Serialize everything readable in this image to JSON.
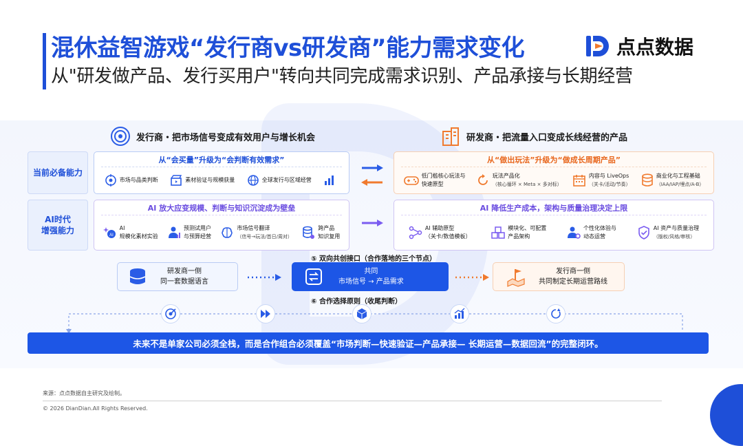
{
  "header": {
    "title": "混休益智游戏“发行商vs研发商”能力需求变化",
    "subtitle": "从\"研发做产品、发行买用户\"转向共同完成需求识别、产品承接与长期经营",
    "logo_text": "点点数据"
  },
  "columns": {
    "publisher_header": "发行商・把市场信号变成有效用户与增长机会",
    "developer_header": "研发商・把流量入口变成长线经营的产品"
  },
  "row_labels": {
    "current": "当前必备能力",
    "ai_line1": "AI时代",
    "ai_line2": "增强能力"
  },
  "publisher_current": {
    "title": "从“会买量”升级为“会判断有效需求”",
    "items": [
      {
        "icon": "target-icon",
        "text": "市场与品类判断"
      },
      {
        "icon": "clapper-icon",
        "text": "素材验证与规模获量"
      },
      {
        "icon": "globe-icon",
        "text": "全球发行与区域经营"
      },
      {
        "icon": "bar-chart-icon",
        "text": ""
      }
    ]
  },
  "developer_current": {
    "title": "从“做出玩法”升级为“做成长周期产品”",
    "items": [
      {
        "icon": "gamepad-icon",
        "line1": "低门槛核心玩法与",
        "line2": "快速原型"
      },
      {
        "icon": "cycle-icon",
        "line1": "玩法产品化",
        "line2": "（核心循环 × Meta × 多对标）"
      },
      {
        "icon": "calendar-icon",
        "line1": "内容与 LiveOps",
        "line2": "（关卡/活动/节奏）"
      },
      {
        "icon": "database-icon",
        "line1": "商业化与工程基础",
        "line2": "（IAA/IAP/埋点/A-B）"
      }
    ]
  },
  "publisher_ai": {
    "title": "AI 放大应变规模、判断与知识沉淀成为壁垒",
    "items": [
      {
        "icon": "ai-sparkle-icon",
        "line1": "AI",
        "line2": "规模化素材实验"
      },
      {
        "icon": "person-chart-icon",
        "line1": "预测试用户",
        "line2": "与预算经营"
      },
      {
        "icon": "brain-icon",
        "line1": "市场信号翻译",
        "line2": "（信号→玩法/首日/周对）"
      },
      {
        "icon": "database-stack-icon",
        "line1": "跨产品",
        "line2": "知识复用"
      }
    ]
  },
  "developer_ai": {
    "title": "AI 降低生产成本，架构与质量治理决定上限",
    "items": [
      {
        "icon": "nodes-icon",
        "line1": "AI 辅助原型",
        "line2": "（关卡/数值模板）"
      },
      {
        "icon": "cubes-icon",
        "line1": "模块化、可配置",
        "line2": "产品架构"
      },
      {
        "icon": "person-gear-icon",
        "line1": "个性化体验与",
        "line2": "动态运营"
      },
      {
        "icon": "shield-check-icon",
        "line1": "AI 资产与质量治理",
        "line2": "（版权/风格/审核）"
      }
    ]
  },
  "collab": {
    "interface_label": "⑤ 双向共创接口（合作落地的三个节点）",
    "left_node_line1": "研发商一侧",
    "left_node_line2": "同一套数据语言",
    "center_node_line1": "共同",
    "center_node_line2": "市场信号 → 产品需求",
    "right_node_line1": "发行商一侧",
    "right_node_line2": "共同制定长期运营路线",
    "principle_label": "⑥ 合作选择原则（收尾判断）"
  },
  "flow_icons": [
    "target-arrow-icon",
    "fast-forward-icon",
    "cube-icon",
    "growth-chart-icon",
    "loop-icon"
  ],
  "banner": "未来不是单家公司必须全栈，而是合作组合必须覆盖“市场判断—快速验证—产品承接— 长期运营—数据回流”的完整闭环。",
  "footer": {
    "source": "来源：点点数据自主研究及绘制。",
    "copyright": "© 2026 DianDian.All Rights Reserved."
  },
  "colors": {
    "brand_blue": "#1e4fd8",
    "publisher_blue": "#2a5ce6",
    "developer_orange": "#f07a2e",
    "ai_purple": "#7a5cf0"
  }
}
